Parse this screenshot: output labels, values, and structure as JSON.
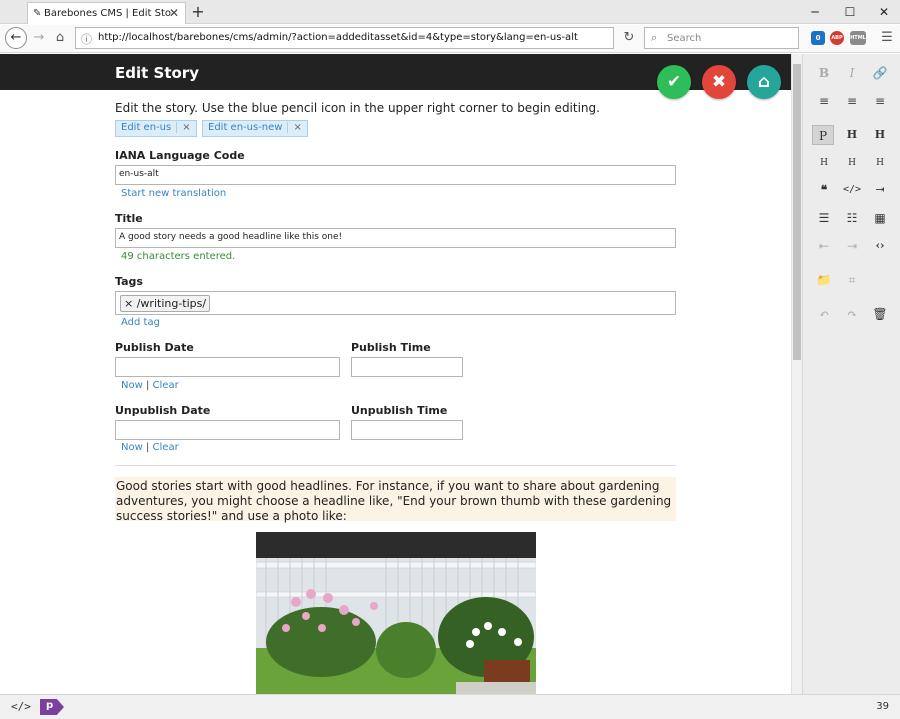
{
  "browser": {
    "tab_title": "Barebones CMS | Edit Story | A good story needs a good headline like this one!",
    "tab_favicon": "pencil-favicon",
    "url": "http://localhost/barebones/cms/admin/?action=addeditasset&id=4&type=story&lang=en-us-alt",
    "search_placeholder": "Search",
    "ext_badge": "0",
    "ext_abp": "ABP",
    "ext_other": "HTML"
  },
  "header": {
    "title": "Edit Story",
    "save_color": "#2ebd59",
    "cancel_color": "#e2463b",
    "home_color": "#26a69a"
  },
  "intro": "Edit the story.  Use the blue pencil icon in the upper right corner to begin editing.",
  "lang_tabs": [
    {
      "label": "Edit en-us"
    },
    {
      "label": "Edit en-us-new"
    }
  ],
  "form": {
    "iana_label": "IANA Language Code",
    "iana_value": "en-us-alt",
    "new_translation": "Start new translation",
    "title_label": "Title",
    "title_value": "A good story needs a good headline like this one!",
    "title_count": "49 characters entered.",
    "tags_label": "Tags",
    "tag_value": "/writing-tips/",
    "add_tag": "Add tag",
    "publish_date_label": "Publish Date",
    "publish_time_label": "Publish Time",
    "unpublish_date_label": "Unpublish Date",
    "unpublish_time_label": "Unpublish Time",
    "now": "Now",
    "clear": "Clear",
    "divider": "|"
  },
  "story_text": "Good stories start with good headlines.  For instance, if you want to share about gardening adventures, you might choose a headline like, \"End your brown thumb with these gardening success stories!\" and use a photo like:",
  "statusbar": {
    "source": "</>",
    "tag": "p",
    "count": "39"
  }
}
